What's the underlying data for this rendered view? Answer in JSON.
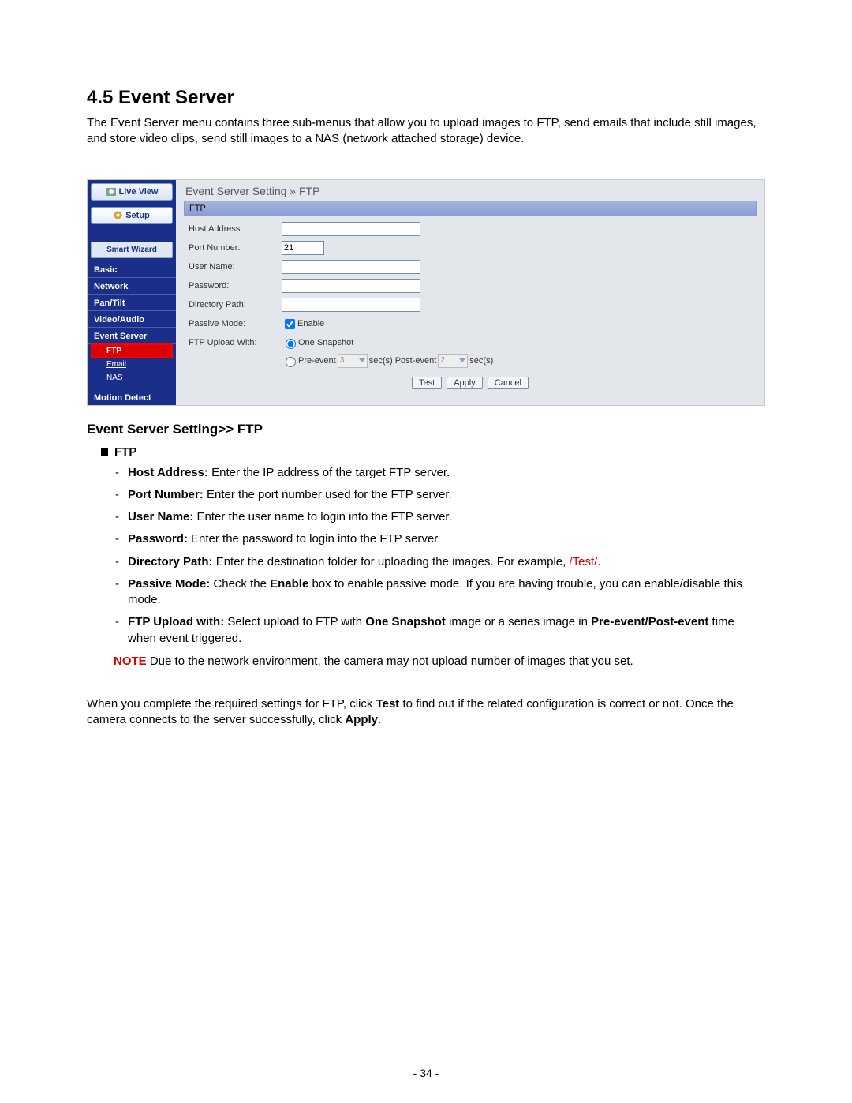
{
  "heading": "4.5  Event Server",
  "intro": "The Event Server menu contains three sub-menus that allow you to upload images to FTP, send emails that include still images, and store video clips, send still images to a NAS (network attached storage) device.",
  "sidebar": {
    "live_view": "Live View",
    "setup": "Setup",
    "smart_wizard": "Smart Wizard",
    "items": [
      "Basic",
      "Network",
      "Pan/Tilt",
      "Video/Audio",
      "Event Server"
    ],
    "subs": [
      "FTP",
      "Email",
      "NAS"
    ],
    "motion": "Motion Detect"
  },
  "panel": {
    "title": "Event Server Setting » FTP",
    "section": "FTP",
    "labels": {
      "host": "Host Address:",
      "port": "Port Number:",
      "user": "User Name:",
      "pass": "Password:",
      "dir": "Directory Path:",
      "passive": "Passive Mode:",
      "upload": "FTP Upload With:"
    },
    "values": {
      "port": "21",
      "enable": "Enable",
      "one_snapshot": "One Snapshot",
      "pre_label": "Pre-event",
      "pre_val": "3",
      "secs1": "sec(s)  Post-event",
      "post_val": "2",
      "secs2": "sec(s)"
    },
    "buttons": {
      "test": "Test",
      "apply": "Apply",
      "cancel": "Cancel"
    }
  },
  "subheading": "Event Server Setting>> FTP",
  "ftp_label": "FTP",
  "desc": {
    "host_b": "Host Address: ",
    "host_t": "Enter the IP address of the target FTP server.",
    "port_b": "Port Number: ",
    "port_t": "Enter the port number used for the FTP server.",
    "user_b": "User Name: ",
    "user_t": "Enter the user name to login into the FTP server.",
    "pass_b": "Password: ",
    "pass_t": "Enter the password to login into the FTP server.",
    "dir_b": "Directory Path: ",
    "dir_t1": "Enter the destination folder for uploading the images. For example, ",
    "dir_t2": "/Test/",
    "dir_t3": ".",
    "pm_b": "Passive Mode: ",
    "pm_t1": "Check the ",
    "pm_t2": "Enable",
    "pm_t3": " box to enable passive mode.  If you are having trouble, you can enable/disable this mode.",
    "up_b": "FTP Upload with: ",
    "up_t1": "Select upload to FTP with ",
    "up_t2": "One Snapshot",
    "up_t3": " image or a series image in ",
    "up_t4": "Pre-event/Post-event",
    "up_t5": " time when event triggered."
  },
  "note": {
    "label": "NOTE",
    "text": "   Due to the network environment, the camera may not upload number of images that you set."
  },
  "outro1": "When you complete the required settings for FTP, click ",
  "outro2": "Test",
  "outro3": " to find out if the related configuration is correct or not. Once the camera connects to the server successfully, click ",
  "outro4": "Apply",
  "outro5": ".",
  "pagenum": "- 34 -"
}
